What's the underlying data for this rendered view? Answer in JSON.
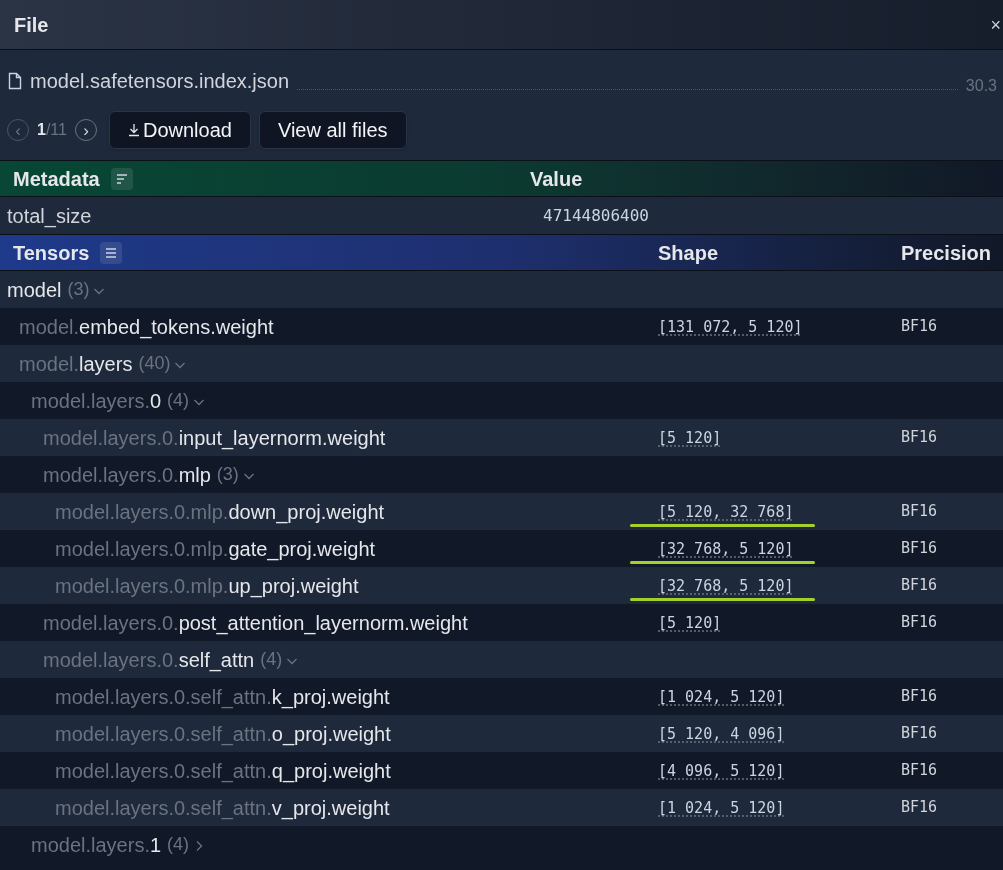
{
  "dialog": {
    "title": "File",
    "close": "×"
  },
  "file": {
    "name": "model.safetensors.index.json",
    "size": "30.3"
  },
  "pager": {
    "prev": "‹",
    "current": "1",
    "total": "/11",
    "next": "›"
  },
  "buttons": [
    {
      "kind": "download",
      "label": "Download"
    },
    {
      "kind": "plain",
      "label": "View all files"
    }
  ],
  "metadata": {
    "columns": [
      "Metadata",
      "Value"
    ],
    "rows": [
      {
        "key": "total_size",
        "value": "47144806400"
      }
    ]
  },
  "tensors": {
    "columns": [
      "Tensors",
      "Shape",
      "Precision"
    ],
    "rows": [
      {
        "prefix": "",
        "name": "model",
        "count": "(3)",
        "expanded": true,
        "children": [
          {
            "prefix": "model.",
            "name": "embed_tokens.weight",
            "shape": "[131 072, 5 120]",
            "precision": "BF16",
            "highlighted": false
          },
          {
            "prefix": "model.",
            "name": "layers",
            "count": "(40)",
            "expanded": true,
            "children": [
              {
                "prefix": "model.layers.",
                "name": "0",
                "count": "(4)",
                "expanded": true,
                "children": [
                  {
                    "prefix": "model.layers.0.",
                    "name": "input_layernorm.weight",
                    "shape": "[5 120]",
                    "precision": "BF16",
                    "highlighted": false
                  },
                  {
                    "prefix": "model.layers.0.",
                    "name": "mlp",
                    "count": "(3)",
                    "expanded": true,
                    "children": [
                      {
                        "prefix": "model.layers.0.mlp.",
                        "name": "down_proj.weight",
                        "shape": "[5 120, 32 768]",
                        "precision": "BF16",
                        "highlighted": true
                      },
                      {
                        "prefix": "model.layers.0.mlp.",
                        "name": "gate_proj.weight",
                        "shape": "[32 768, 5 120]",
                        "precision": "BF16",
                        "highlighted": true
                      },
                      {
                        "prefix": "model.layers.0.mlp.",
                        "name": "up_proj.weight",
                        "shape": "[32 768, 5 120]",
                        "precision": "BF16",
                        "highlighted": true
                      }
                    ]
                  },
                  {
                    "prefix": "model.layers.0.",
                    "name": "post_attention_layernorm.weight",
                    "shape": "[5 120]",
                    "precision": "BF16",
                    "highlighted": false
                  },
                  {
                    "prefix": "model.layers.0.",
                    "name": "self_attn",
                    "count": "(4)",
                    "expanded": true,
                    "children": [
                      {
                        "prefix": "model.layers.0.self_attn.",
                        "name": "k_proj.weight",
                        "shape": "[1 024, 5 120]",
                        "precision": "BF16",
                        "highlighted": false
                      },
                      {
                        "prefix": "model.layers.0.self_attn.",
                        "name": "o_proj.weight",
                        "shape": "[5 120, 4 096]",
                        "precision": "BF16",
                        "highlighted": false
                      },
                      {
                        "prefix": "model.layers.0.self_attn.",
                        "name": "q_proj.weight",
                        "shape": "[4 096, 5 120]",
                        "precision": "BF16",
                        "highlighted": false
                      },
                      {
                        "prefix": "model.layers.0.self_attn.",
                        "name": "v_proj.weight",
                        "shape": "[1 024, 5 120]",
                        "precision": "BF16",
                        "highlighted": false
                      }
                    ]
                  }
                ]
              },
              {
                "prefix": "model.layers.",
                "name": "1",
                "count": "(4)",
                "expanded": false
              }
            ]
          }
        ]
      }
    ]
  }
}
